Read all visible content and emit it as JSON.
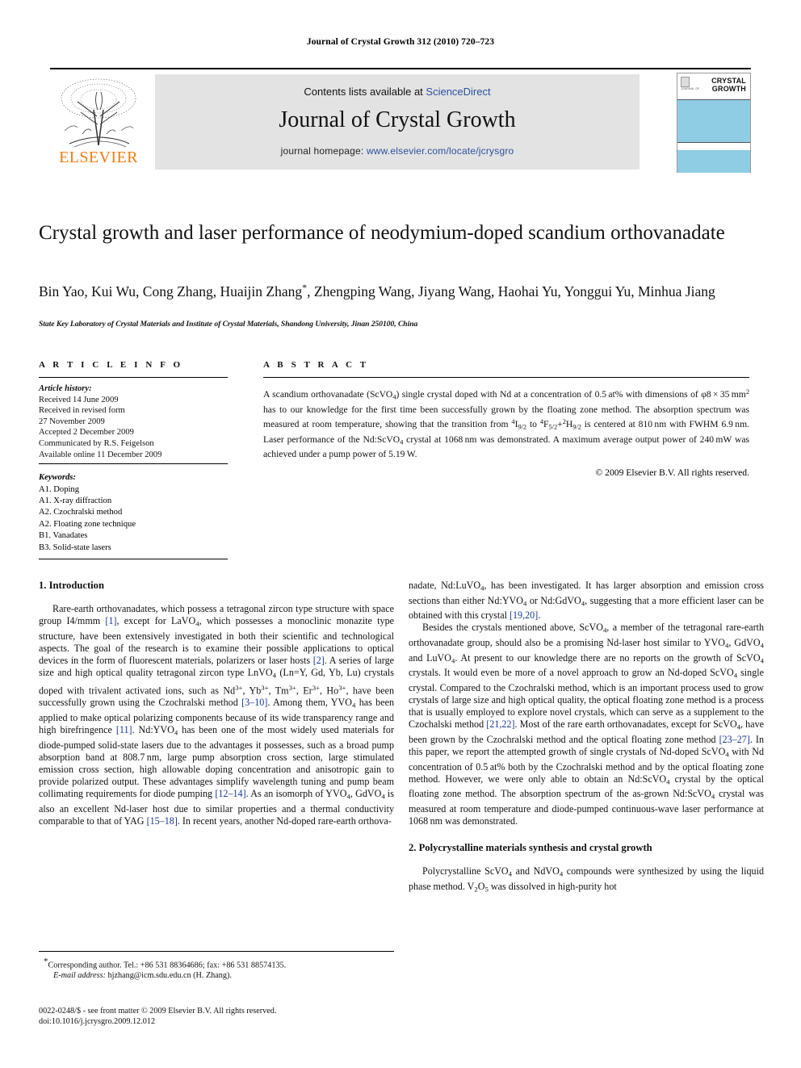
{
  "running_head": "Journal of Crystal Growth 312 (2010) 720–723",
  "masthead": {
    "publisher_name": "ELSEVIER",
    "contents_prefix": "Contents lists available at ",
    "contents_link": "ScienceDirect",
    "journal_title": "Journal of Crystal Growth",
    "homepage_prefix": "journal homepage: ",
    "homepage_url": "www.elsevier.com/locate/jcrysgro",
    "cover": {
      "logo_caption": "JOURNAL OF",
      "line1": "CRYSTAL",
      "line2": "GROWTH",
      "band_color": "#8ecde4"
    }
  },
  "article": {
    "title": "Crystal growth and laser performance of neodymium-doped scandium orthovanadate",
    "authors": "Bin Yao, Kui Wu, Cong Zhang, Huaijin Zhang*, Zhengping Wang, Jiyang Wang, Haohai Yu, Yonggui Yu, Minhua Jiang",
    "affiliation": "State Key Laboratory of Crystal Materials and Institute of Crystal Materials, Shandong University, Jinan 250100, China"
  },
  "article_info": {
    "heading": "A R T I C L E  I N F O",
    "history_label": "Article history:",
    "history": [
      "Received 14 June 2009",
      "Received in revised form",
      "27 November 2009",
      "Accepted 2 December 2009",
      "Communicated by R.S. Feigelson",
      "Available online 11 December 2009"
    ],
    "keywords_label": "Keywords:",
    "keywords": [
      "A1. Doping",
      "A1. X-ray diffraction",
      "A2. Czochralski method",
      "A2. Floating zone technique",
      "B1. Vanadates",
      "B3. Solid-state lasers"
    ]
  },
  "abstract": {
    "heading": "A B S T R A C T",
    "copyright": "© 2009 Elsevier B.V. All rights reserved."
  },
  "sections": {
    "introduction_heading": "1. Introduction",
    "polycrystalline_heading": "2. Polycrystalline materials synthesis and crystal growth"
  },
  "footnote": {
    "corresponding": "Corresponding author. Tel.: +86 531 88364686; fax: +86 531 88574135.",
    "email_label": "E-mail address:",
    "email": "hjzhang@icm.sdu.edu.cn (H. Zhang)."
  },
  "footer": {
    "issn_line": "0022-0248/$ - see front matter © 2009 Elsevier B.V. All rights reserved.",
    "doi_line": "doi:10.1016/j.jcrysgro.2009.12.012"
  },
  "colors": {
    "link": "#2b4f9e",
    "reference": "#1b3a8f",
    "elsevier_orange": "#f07c10",
    "masthead_bg": "#e3e3e3"
  }
}
